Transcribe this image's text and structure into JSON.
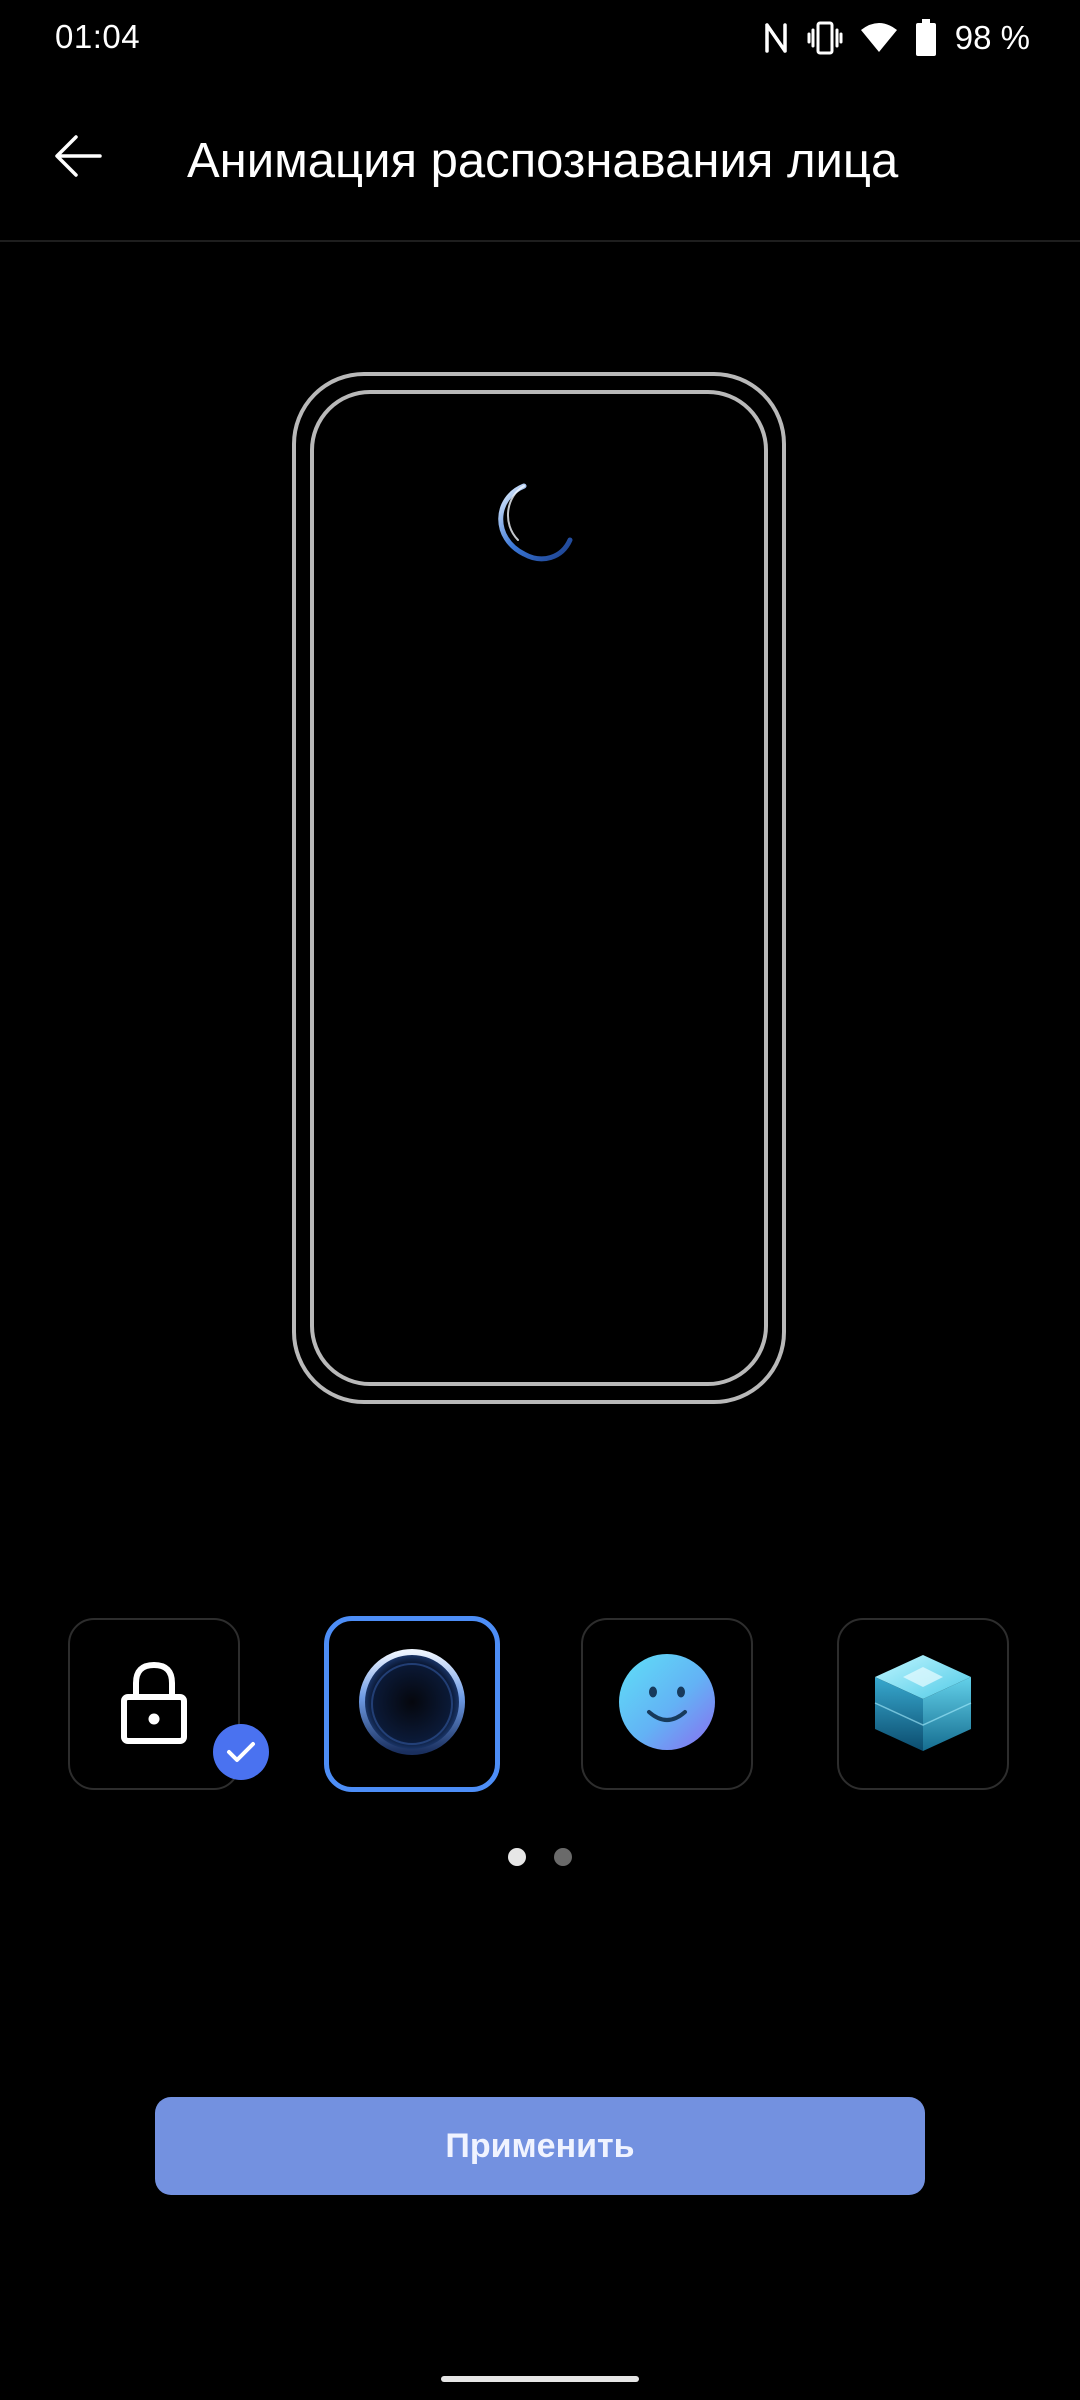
{
  "status_bar": {
    "time": "01:04",
    "battery": "98 %",
    "icons": [
      "nfc-icon",
      "vibrate-icon",
      "wifi-icon",
      "battery-icon"
    ]
  },
  "app_bar": {
    "back_icon": "arrow-back-icon",
    "title": "Анимация распознавания лица"
  },
  "preview": {
    "animation": "blue-arc-animation"
  },
  "options": [
    {
      "icon": "lock-icon",
      "checked": true,
      "selected": false
    },
    {
      "icon": "ring-glow-icon",
      "checked": false,
      "selected": true
    },
    {
      "icon": "smiley-face-icon",
      "checked": false,
      "selected": false
    },
    {
      "icon": "cube-icon",
      "checked": false,
      "selected": false
    }
  ],
  "page_indicator": {
    "pages": 2,
    "current": 1
  },
  "apply_button": {
    "label": "Применить"
  },
  "colors": {
    "background": "#000000",
    "accent": "#4d8ef7",
    "apply_button": "#7391e0",
    "check_badge": "#4a72f0"
  }
}
